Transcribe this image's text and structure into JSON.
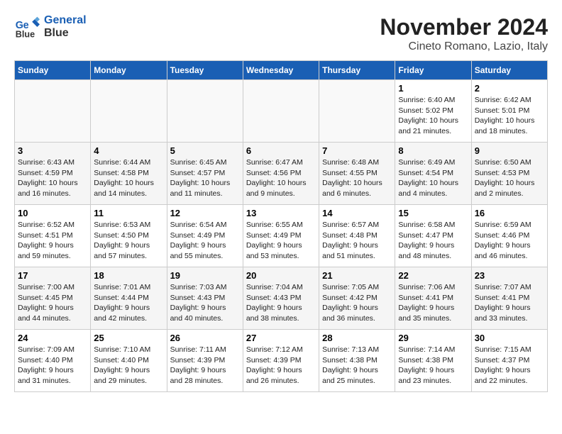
{
  "header": {
    "logo_line1": "General",
    "logo_line2": "Blue",
    "month_title": "November 2024",
    "subtitle": "Cineto Romano, Lazio, Italy"
  },
  "weekdays": [
    "Sunday",
    "Monday",
    "Tuesday",
    "Wednesday",
    "Thursday",
    "Friday",
    "Saturday"
  ],
  "weeks": [
    [
      {
        "day": "",
        "info": ""
      },
      {
        "day": "",
        "info": ""
      },
      {
        "day": "",
        "info": ""
      },
      {
        "day": "",
        "info": ""
      },
      {
        "day": "",
        "info": ""
      },
      {
        "day": "1",
        "info": "Sunrise: 6:40 AM\nSunset: 5:02 PM\nDaylight: 10 hours\nand 21 minutes."
      },
      {
        "day": "2",
        "info": "Sunrise: 6:42 AM\nSunset: 5:01 PM\nDaylight: 10 hours\nand 18 minutes."
      }
    ],
    [
      {
        "day": "3",
        "info": "Sunrise: 6:43 AM\nSunset: 4:59 PM\nDaylight: 10 hours\nand 16 minutes."
      },
      {
        "day": "4",
        "info": "Sunrise: 6:44 AM\nSunset: 4:58 PM\nDaylight: 10 hours\nand 14 minutes."
      },
      {
        "day": "5",
        "info": "Sunrise: 6:45 AM\nSunset: 4:57 PM\nDaylight: 10 hours\nand 11 minutes."
      },
      {
        "day": "6",
        "info": "Sunrise: 6:47 AM\nSunset: 4:56 PM\nDaylight: 10 hours\nand 9 minutes."
      },
      {
        "day": "7",
        "info": "Sunrise: 6:48 AM\nSunset: 4:55 PM\nDaylight: 10 hours\nand 6 minutes."
      },
      {
        "day": "8",
        "info": "Sunrise: 6:49 AM\nSunset: 4:54 PM\nDaylight: 10 hours\nand 4 minutes."
      },
      {
        "day": "9",
        "info": "Sunrise: 6:50 AM\nSunset: 4:53 PM\nDaylight: 10 hours\nand 2 minutes."
      }
    ],
    [
      {
        "day": "10",
        "info": "Sunrise: 6:52 AM\nSunset: 4:51 PM\nDaylight: 9 hours\nand 59 minutes."
      },
      {
        "day": "11",
        "info": "Sunrise: 6:53 AM\nSunset: 4:50 PM\nDaylight: 9 hours\nand 57 minutes."
      },
      {
        "day": "12",
        "info": "Sunrise: 6:54 AM\nSunset: 4:49 PM\nDaylight: 9 hours\nand 55 minutes."
      },
      {
        "day": "13",
        "info": "Sunrise: 6:55 AM\nSunset: 4:49 PM\nDaylight: 9 hours\nand 53 minutes."
      },
      {
        "day": "14",
        "info": "Sunrise: 6:57 AM\nSunset: 4:48 PM\nDaylight: 9 hours\nand 51 minutes."
      },
      {
        "day": "15",
        "info": "Sunrise: 6:58 AM\nSunset: 4:47 PM\nDaylight: 9 hours\nand 48 minutes."
      },
      {
        "day": "16",
        "info": "Sunrise: 6:59 AM\nSunset: 4:46 PM\nDaylight: 9 hours\nand 46 minutes."
      }
    ],
    [
      {
        "day": "17",
        "info": "Sunrise: 7:00 AM\nSunset: 4:45 PM\nDaylight: 9 hours\nand 44 minutes."
      },
      {
        "day": "18",
        "info": "Sunrise: 7:01 AM\nSunset: 4:44 PM\nDaylight: 9 hours\nand 42 minutes."
      },
      {
        "day": "19",
        "info": "Sunrise: 7:03 AM\nSunset: 4:43 PM\nDaylight: 9 hours\nand 40 minutes."
      },
      {
        "day": "20",
        "info": "Sunrise: 7:04 AM\nSunset: 4:43 PM\nDaylight: 9 hours\nand 38 minutes."
      },
      {
        "day": "21",
        "info": "Sunrise: 7:05 AM\nSunset: 4:42 PM\nDaylight: 9 hours\nand 36 minutes."
      },
      {
        "day": "22",
        "info": "Sunrise: 7:06 AM\nSunset: 4:41 PM\nDaylight: 9 hours\nand 35 minutes."
      },
      {
        "day": "23",
        "info": "Sunrise: 7:07 AM\nSunset: 4:41 PM\nDaylight: 9 hours\nand 33 minutes."
      }
    ],
    [
      {
        "day": "24",
        "info": "Sunrise: 7:09 AM\nSunset: 4:40 PM\nDaylight: 9 hours\nand 31 minutes."
      },
      {
        "day": "25",
        "info": "Sunrise: 7:10 AM\nSunset: 4:40 PM\nDaylight: 9 hours\nand 29 minutes."
      },
      {
        "day": "26",
        "info": "Sunrise: 7:11 AM\nSunset: 4:39 PM\nDaylight: 9 hours\nand 28 minutes."
      },
      {
        "day": "27",
        "info": "Sunrise: 7:12 AM\nSunset: 4:39 PM\nDaylight: 9 hours\nand 26 minutes."
      },
      {
        "day": "28",
        "info": "Sunrise: 7:13 AM\nSunset: 4:38 PM\nDaylight: 9 hours\nand 25 minutes."
      },
      {
        "day": "29",
        "info": "Sunrise: 7:14 AM\nSunset: 4:38 PM\nDaylight: 9 hours\nand 23 minutes."
      },
      {
        "day": "30",
        "info": "Sunrise: 7:15 AM\nSunset: 4:37 PM\nDaylight: 9 hours\nand 22 minutes."
      }
    ]
  ]
}
